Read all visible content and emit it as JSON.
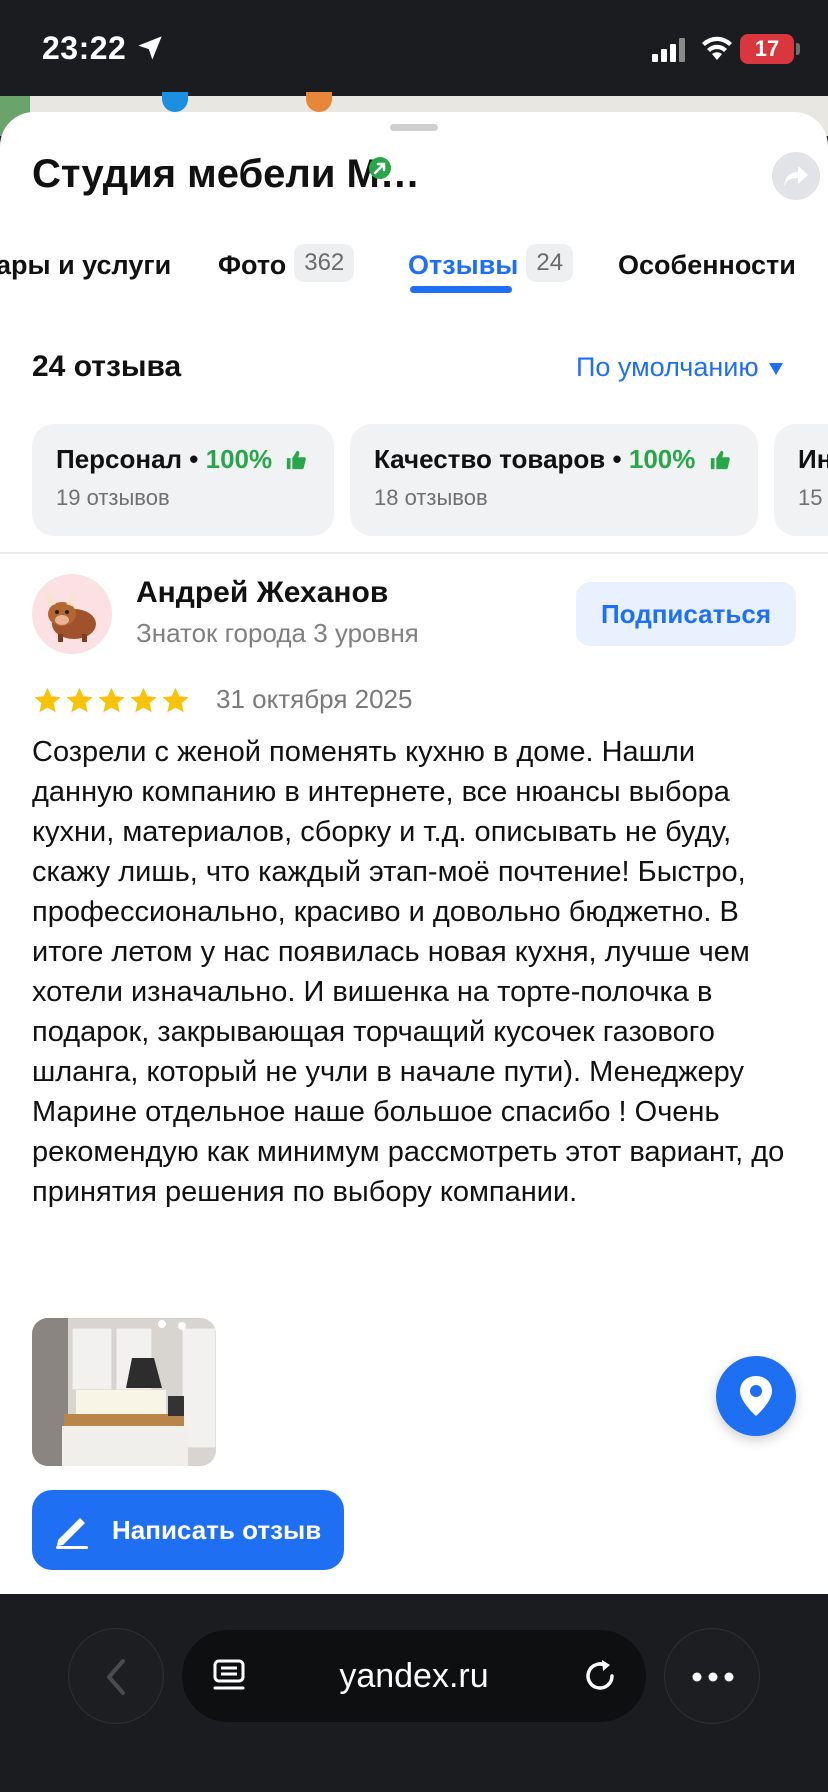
{
  "status_bar": {
    "time": "23:22",
    "battery": "17"
  },
  "place": {
    "title": "Студия мебели М…"
  },
  "tabs": [
    {
      "label": "ары и услуги",
      "count": ""
    },
    {
      "label": "Фото",
      "count": "362"
    },
    {
      "label": "Отзывы",
      "count": "24"
    },
    {
      "label": "Особенности",
      "count": ""
    }
  ],
  "reviews_header": {
    "count": "24 отзыва",
    "sort_label": "По умолчанию"
  },
  "aspects": [
    {
      "name": "Персонал",
      "percent": "100%",
      "reviews": "19 отзывов"
    },
    {
      "name": "Качество товаров",
      "percent": "100%",
      "reviews": "18 отзывов"
    },
    {
      "name": "Ин",
      "percent": "",
      "reviews": "15"
    }
  ],
  "aspect_separator": "•",
  "review": {
    "author": "Андрей Жеханов",
    "level": "Знаток города 3 уровня",
    "subscribe_label": "Подписаться",
    "rating": 5,
    "date": "31 октября 2025",
    "text": "Созрели с женой поменять кухню в доме. Нашли данную компанию в интернете, все нюансы выбора кухни, материалов, сборку и т.д. описывать не буду, скажу лишь, что каждый этап-моё почтение! Быстро, профессионально, красиво и довольно бюджетно. В итоге летом у нас появилась новая кухня, лучше чем хотели изначально. И вишенка на торте-полочка в подарок, закрывающая торчащий кусочек газового шланга, который не учли в начале пути). Менеджеру Марине отдельное наше большое спасибо ! Очень рекомендую как минимум рассмотреть этот вариант, до принятия решения по выбору компании."
  },
  "write_review_label": "Написать отзыв",
  "browser": {
    "url": "yandex.ru"
  },
  "colors": {
    "accent": "#1f6ff2",
    "positive": "#29a64a",
    "star": "#f7c30a",
    "battery": "#d9363e"
  }
}
